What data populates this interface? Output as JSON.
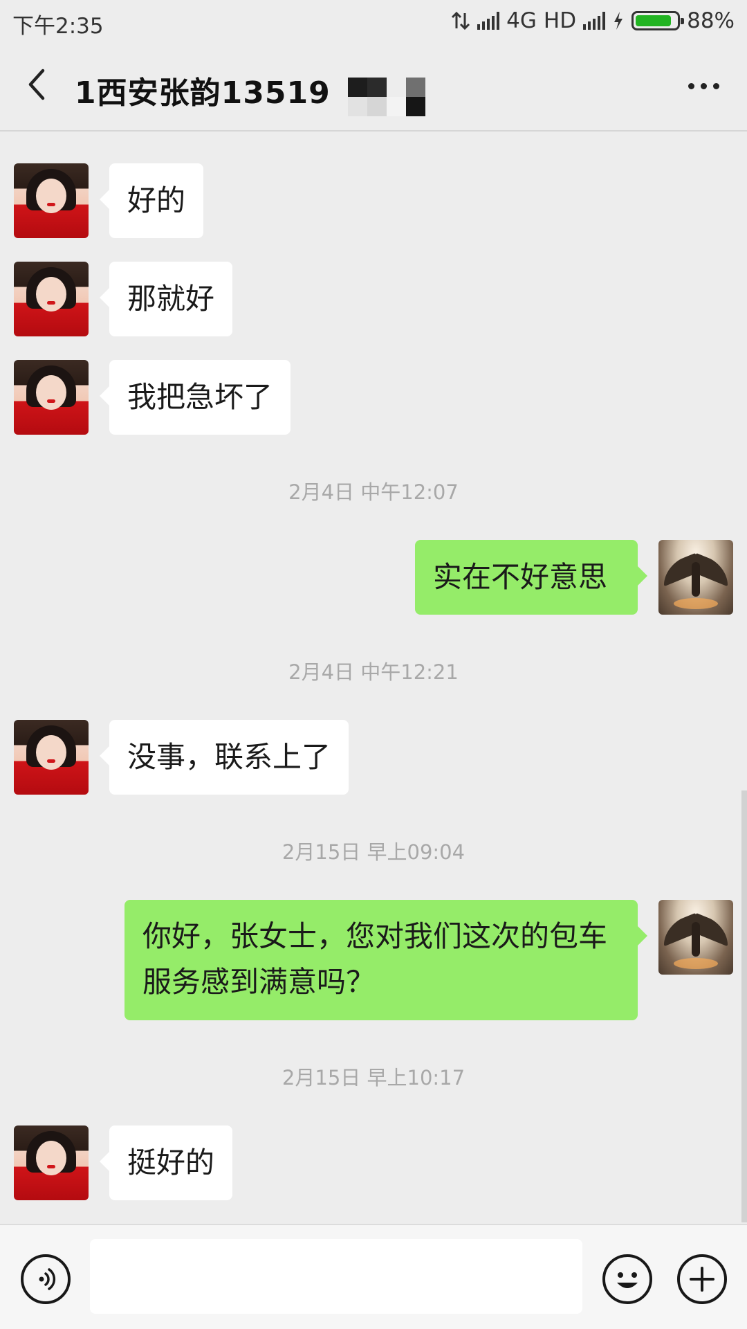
{
  "status_bar": {
    "time": "下午2:35",
    "network": "4G",
    "hd": "HD",
    "battery_percent": "88%",
    "battery_level": 0.88
  },
  "header": {
    "title": "1西安张韵13519",
    "back_icon": "back-chevron-icon",
    "more_icon": "more-dots-icon"
  },
  "messages": [
    {
      "side": "left",
      "text": "好的"
    },
    {
      "side": "left",
      "text": "那就好"
    },
    {
      "side": "left",
      "text": "我把急坏了"
    },
    {
      "type": "time",
      "text": "2月4日 中午12:07"
    },
    {
      "side": "right",
      "text": "实在不好意思"
    },
    {
      "type": "time",
      "text": "2月4日 中午12:21"
    },
    {
      "side": "left",
      "text": "没事，联系上了"
    },
    {
      "type": "time",
      "text": "2月15日 早上09:04"
    },
    {
      "side": "right",
      "lines": [
        "你好，张女士，您对我们这次的包车",
        "服务感到满意吗？"
      ]
    },
    {
      "type": "time",
      "text": "2月15日 早上10:17"
    },
    {
      "side": "left",
      "text": "挺好的"
    }
  ],
  "input_bar": {
    "voice_icon": "voice-icon",
    "emoji_icon": "emoji-icon",
    "plus_icon": "plus-icon",
    "message_value": ""
  },
  "colors": {
    "background": "#ededed",
    "sent_bubble": "#95ec69",
    "received_bubble": "#ffffff",
    "timestamp": "#a8a8a8"
  }
}
